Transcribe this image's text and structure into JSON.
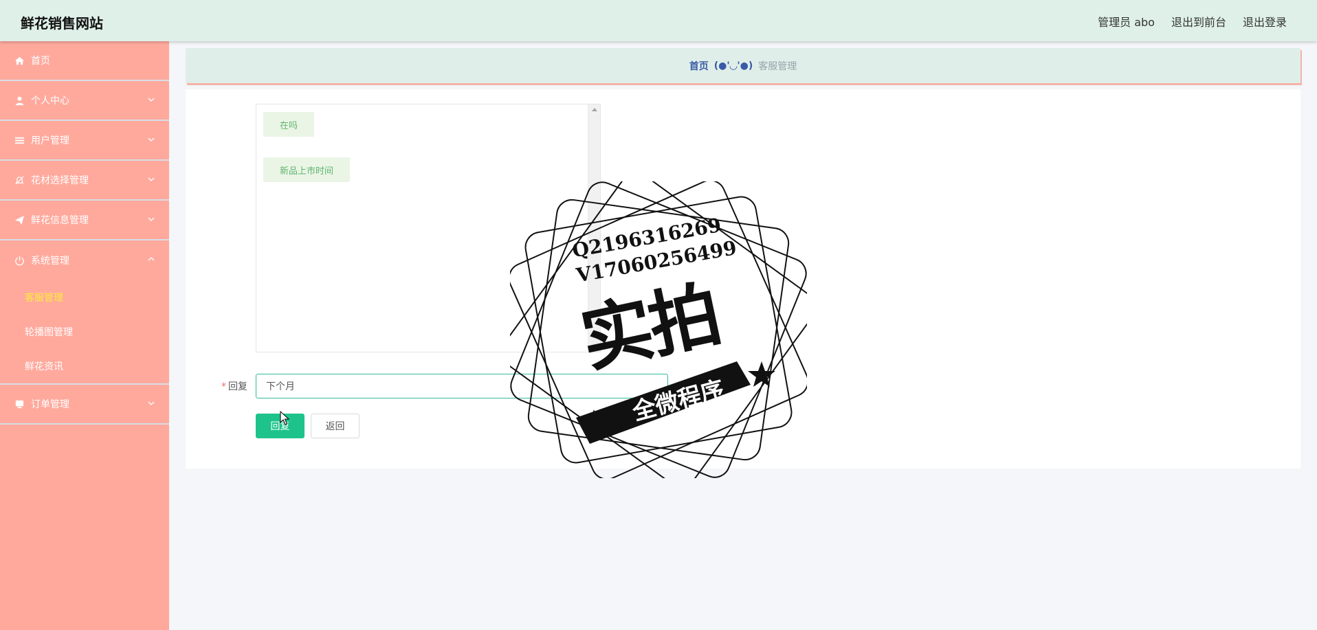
{
  "app": {
    "title": "鲜花销售网站"
  },
  "header": {
    "admin_label": "管理员 abo",
    "to_frontend": "退出到前台",
    "logout": "退出登录"
  },
  "sidebar": {
    "items": [
      {
        "label": "首页",
        "icon": "home-icon"
      },
      {
        "label": "个人中心",
        "icon": "user-icon"
      },
      {
        "label": "用户管理",
        "icon": "list-icon"
      },
      {
        "label": "花材选择管理",
        "icon": "bell-off-icon"
      },
      {
        "label": "鲜花信息管理",
        "icon": "send-icon"
      },
      {
        "label": "系统管理",
        "icon": "power-icon"
      },
      {
        "label": "订单管理",
        "icon": "monitor-icon"
      }
    ],
    "system_sub": [
      {
        "label": "客服管理",
        "active": true
      },
      {
        "label": "轮播图管理",
        "active": false
      },
      {
        "label": "鲜花资讯",
        "active": false
      }
    ]
  },
  "breadcrumb": {
    "home": "首页",
    "separator": "(●'◡'●)",
    "current": "客服管理"
  },
  "chat": {
    "messages": [
      "在吗",
      "新品上市时间"
    ]
  },
  "form": {
    "reply_label": "回复",
    "required_mark": "*",
    "reply_value": "下个月",
    "reply_button": "回复",
    "back_button": "返回"
  },
  "watermark": {
    "line1": "Q2196316269",
    "line2": "V17060256499",
    "big": "实拍",
    "ribbon": "全微程序"
  },
  "colors": {
    "header_bg": "#dff0e9",
    "sidebar_bg": "#ffa99d",
    "active_sub": "#ffeb3b",
    "primary_button": "#1ec38b",
    "breadcrumb_home": "#3a5ba7"
  }
}
